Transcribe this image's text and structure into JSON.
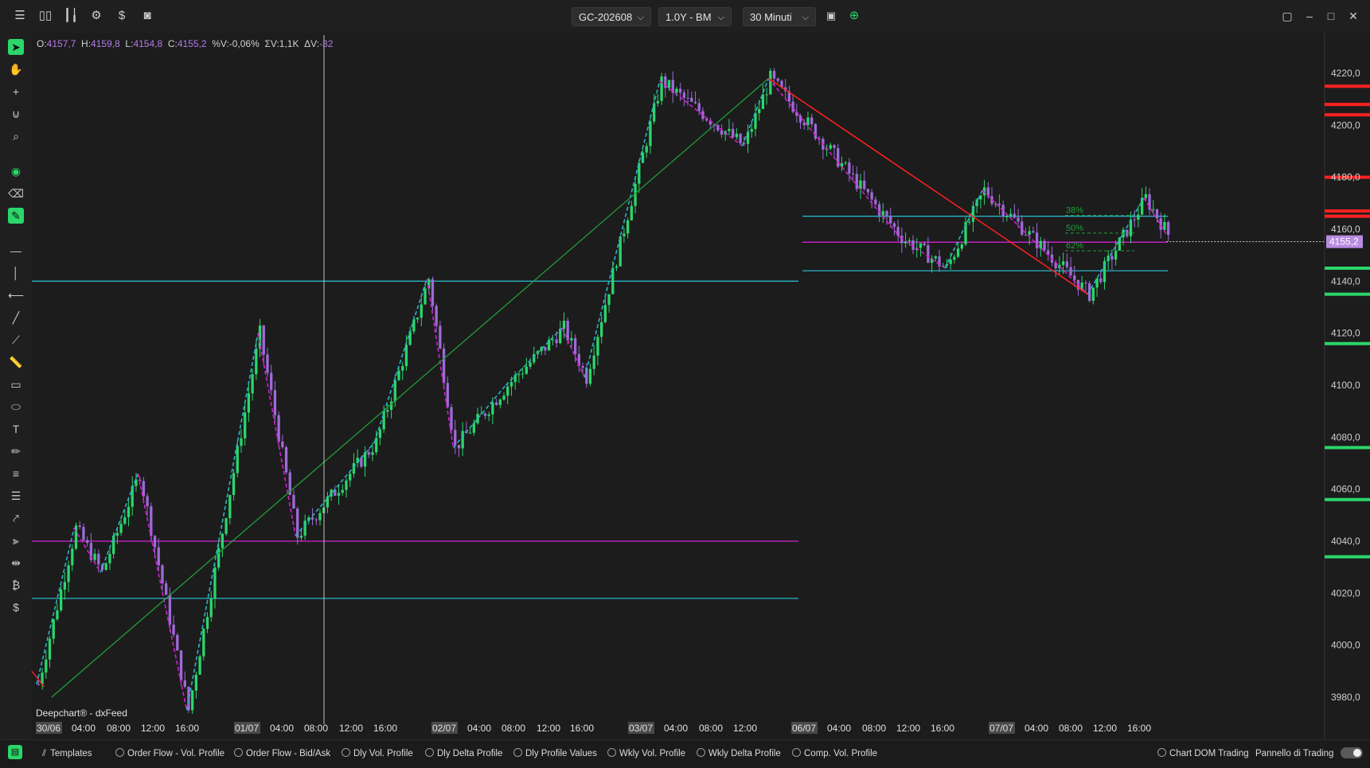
{
  "topbar": {
    "symbol": "GC-202608",
    "range": "1.0Y - BM",
    "timeframe": "30 Minuti",
    "icons": [
      "menu-icon",
      "candles-icon",
      "bars-icon",
      "settings-icon",
      "dollar-icon",
      "camera-icon"
    ]
  },
  "ohlc": {
    "o_label": "O:",
    "o": "4157,7",
    "h_label": "H:",
    "h": "4159,8",
    "l_label": "L:",
    "l": "4154,8",
    "c_label": "C:",
    "c": "4155,2",
    "v_label": "%V:",
    "v": "-0,06%",
    "sv_label": "ΣV:",
    "sv": "1,1K",
    "dv_label": "ΔV:",
    "dv": "-32"
  },
  "footer_label": "Deepchart® - dxFeed",
  "price_axis": {
    "labels": [
      "4220,0",
      "4200,0",
      "4180,0",
      "4160,0",
      "4140,0",
      "4120,0",
      "4100,0",
      "4080,0",
      "4060,0",
      "4040,0",
      "4020,0",
      "4000,0",
      "3980,0"
    ],
    "current": "4155,2"
  },
  "time_axis": {
    "labels": [
      "30/06",
      "04:00",
      "08:00",
      "12:00",
      "16:00",
      "01/07",
      "04:00",
      "08:00",
      "12:00",
      "16:00",
      "02/07",
      "04:00",
      "08:00",
      "12:00",
      "16:00",
      "03/07",
      "04:00",
      "08:00",
      "12:00",
      "06/07",
      "04:00",
      "08:00",
      "12:00",
      "16:00",
      "07/07",
      "04:00",
      "08:00",
      "12:00",
      "16:00"
    ]
  },
  "fib": [
    "38%",
    "50%",
    "62%"
  ],
  "chart_data": {
    "type": "candlestick",
    "symbol": "GC-202608",
    "timeframe": "30 Minuti",
    "ylim": [
      3970,
      4225
    ],
    "last": 4155.2,
    "zigzag_points": [
      [
        0,
        3985
      ],
      [
        10,
        4045
      ],
      [
        17,
        4028
      ],
      [
        27,
        4066
      ],
      [
        40,
        3975
      ],
      [
        59,
        4120
      ],
      [
        69,
        4042
      ],
      [
        90,
        4078
      ],
      [
        104,
        4141
      ],
      [
        111,
        4076
      ],
      [
        125,
        4100
      ],
      [
        140,
        4122
      ],
      [
        146,
        4103
      ],
      [
        166,
        4217
      ],
      [
        188,
        4192
      ],
      [
        195,
        4218
      ],
      [
        230,
        4157
      ],
      [
        242,
        4145
      ],
      [
        252,
        4175
      ],
      [
        280,
        4135
      ],
      [
        295,
        4172
      ],
      [
        301,
        4158
      ]
    ],
    "horizontal_levels": [
      {
        "price": 4140,
        "color": "#29b3c7"
      },
      {
        "price": 4040,
        "color": "#d11fd1"
      },
      {
        "price": 4018,
        "color": "#29b3c7"
      },
      {
        "price": 4165,
        "color": "#29b3c7"
      },
      {
        "price": 4155,
        "color": "#d11fd1"
      },
      {
        "price": 4144,
        "color": "#29b3c7"
      }
    ],
    "dom_levels": [
      {
        "price": 4215,
        "color": "#ff2020"
      },
      {
        "price": 4208,
        "color": "#ff2020"
      },
      {
        "price": 4204,
        "color": "#ff2020"
      },
      {
        "price": 4180,
        "color": "#ff2020"
      },
      {
        "price": 4167,
        "color": "#ff2020"
      },
      {
        "price": 4165,
        "color": "#ff2020"
      },
      {
        "price": 4145,
        "color": "#2bd66a"
      },
      {
        "price": 4135,
        "color": "#2bd66a"
      },
      {
        "price": 4116,
        "color": "#2bd66a"
      },
      {
        "price": 4076,
        "color": "#2bd66a"
      },
      {
        "price": 4056,
        "color": "#2bd66a"
      },
      {
        "price": 4034,
        "color": "#2bd66a"
      }
    ]
  },
  "bottombar": {
    "templates_label": "Templates",
    "templates": [
      "Order Flow - Vol. Profile",
      "Order Flow - Bid/Ask",
      "Dly Vol. Profile",
      "Dly Delta Profile",
      "Dly Profile Values",
      "Wkly Vol. Profile",
      "Wkly Delta Profile",
      "Comp. Vol. Profile"
    ],
    "chart_dom_label": "Chart DOM Trading",
    "panel_label": "Pannello di Trading"
  },
  "colors": {
    "bull": "#2bd66a",
    "bear": "#9d6bd8",
    "magenta": "#d11fd1",
    "cyan": "#29b3c7",
    "red": "#ff2020",
    "green": "#2bd66a",
    "bg": "#1c1c1c"
  }
}
